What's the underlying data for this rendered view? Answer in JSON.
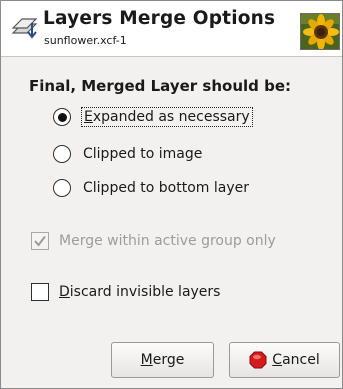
{
  "header": {
    "title": "Layers Merge Options",
    "subtitle": "sunflower.xcf-1",
    "icon": "layers-merge-icon",
    "thumbnail": "sunflower-thumbnail"
  },
  "section": {
    "title": "Final, Merged Layer should be:"
  },
  "options": [
    {
      "label_mnemonic": "E",
      "label_rest": "xpanded as necessary",
      "selected": true
    },
    {
      "label": "Clipped to image",
      "selected": false
    },
    {
      "label": "Clipped to bottom layer",
      "selected": false
    }
  ],
  "checks": {
    "merge_group": {
      "label": "Merge within active group only",
      "checked": true,
      "disabled": true
    },
    "discard": {
      "label_mnemonic": "D",
      "label_rest": "iscard invisible layers",
      "checked": false
    }
  },
  "buttons": {
    "merge": {
      "mnemonic": "M",
      "rest": "erge"
    },
    "cancel": {
      "mnemonic": "C",
      "rest": "ancel",
      "icon": "stop-icon"
    }
  },
  "colors": {
    "dialog_bg": "#f2f1f0",
    "header_bg": "#ffffff",
    "stop_red": "#d41a1a"
  }
}
